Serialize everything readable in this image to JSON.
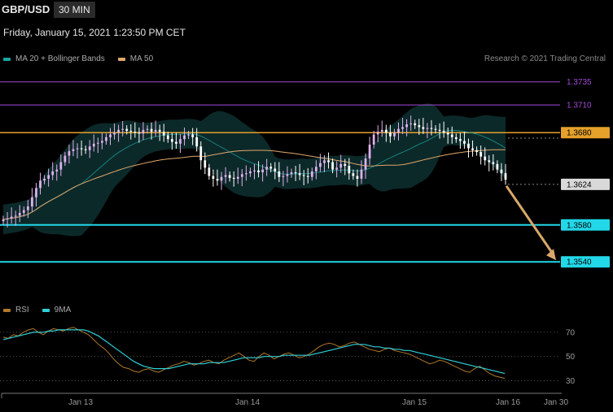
{
  "header": {
    "symbol": "GBP/USD",
    "timeframe": "30 MIN",
    "datetime": "Friday, January 15, 2021 1:23:50 PM CET"
  },
  "legend": {
    "main": [
      {
        "label": "MA 20 + Bollinger Bands",
        "color": "#1aa6a6"
      },
      {
        "label": "MA 50",
        "color": "#e0a86a"
      }
    ],
    "rsi": [
      {
        "label": "RSI",
        "color": "#b07a2a"
      },
      {
        "label": "9MA",
        "color": "#2fd0d8"
      }
    ]
  },
  "credit": "Research © 2021 Trading Central",
  "colors": {
    "background": "#000000",
    "resistance_purple": "#a24bd6",
    "pivot_orange": "#e5a12a",
    "support_cyan": "#22d8e8",
    "last_price_label": "#d9d9d9",
    "arrow": "#d9a86a",
    "candle_up": "#e0b0ee",
    "candle_down": "#ffffff",
    "band_fill": "#0d2e2e"
  },
  "chart_data": [
    {
      "type": "candlestick",
      "title": "GBP/USD 30 MIN",
      "ylim": [
        1.3505,
        1.3755
      ],
      "x_ticks": [
        "Jan 13",
        "Jan 14",
        "Jan 15",
        "Jan 16",
        "Jan 30"
      ],
      "levels": [
        {
          "value": 1.3735,
          "label": "1.3735",
          "kind": "resistance"
        },
        {
          "value": 1.371,
          "label": "1.3710",
          "kind": "resistance"
        },
        {
          "value": 1.368,
          "label": "1.3680",
          "kind": "pivot"
        },
        {
          "value": 1.3624,
          "label": "1.3624",
          "kind": "last_price"
        },
        {
          "value": 1.358,
          "label": "1.3580",
          "kind": "support"
        },
        {
          "value": 1.354,
          "label": "1.3540",
          "kind": "support"
        }
      ],
      "close_series": [
        1.3586,
        1.3587,
        1.3589,
        1.359,
        1.3593,
        1.3596,
        1.36,
        1.361,
        1.362,
        1.3628,
        1.363,
        1.3634,
        1.3638,
        1.364,
        1.3648,
        1.3655,
        1.366,
        1.3662,
        1.3663,
        1.3662,
        1.3661,
        1.3665,
        1.3668,
        1.3669,
        1.3671,
        1.3675,
        1.3678,
        1.368,
        1.3683,
        1.3684,
        1.3682,
        1.3681,
        1.368,
        1.3679,
        1.3683,
        1.3684,
        1.3681,
        1.3683,
        1.3681,
        1.3677,
        1.3673,
        1.367,
        1.3668,
        1.3673,
        1.3677,
        1.3678,
        1.3675,
        1.3665,
        1.365,
        1.3642,
        1.3633,
        1.363,
        1.3628,
        1.3632,
        1.3634,
        1.3631,
        1.363,
        1.3632,
        1.3635,
        1.3636,
        1.3638,
        1.3639,
        1.3637,
        1.364,
        1.3643,
        1.3641,
        1.3638,
        1.3632,
        1.3633,
        1.3635,
        1.3637,
        1.3636,
        1.3634,
        1.3633,
        1.3632,
        1.3638,
        1.3643,
        1.3647,
        1.365,
        1.3648,
        1.364,
        1.3642,
        1.3646,
        1.3644,
        1.3636,
        1.3633,
        1.363,
        1.364,
        1.3652,
        1.3667,
        1.3678,
        1.3681,
        1.3683,
        1.368,
        1.3676,
        1.368,
        1.3684,
        1.3686,
        1.3689,
        1.369,
        1.3688,
        1.3686,
        1.3684,
        1.3685,
        1.3684,
        1.3683,
        1.3682,
        1.368,
        1.3678,
        1.3675,
        1.3673,
        1.3671,
        1.3668,
        1.3663,
        1.3661,
        1.3659,
        1.3654,
        1.365,
        1.3648,
        1.3646,
        1.364,
        1.3636,
        1.3629
      ],
      "projection": {
        "from": 1.3624,
        "to": 1.354
      }
    },
    {
      "type": "line",
      "title": "RSI",
      "ylim": [
        25,
        80
      ],
      "y_ticks": [
        70,
        50,
        30
      ],
      "series": [
        {
          "name": "RSI",
          "values": [
            66,
            65,
            68,
            67,
            70,
            72,
            73,
            70,
            68,
            71,
            73,
            72,
            71,
            73,
            74,
            72,
            70,
            68,
            64,
            60,
            57,
            53,
            48,
            44,
            41,
            40,
            38,
            37,
            39,
            40,
            38,
            37,
            39,
            41,
            43,
            44,
            46,
            45,
            43,
            44,
            46,
            47,
            45,
            44,
            47,
            49,
            51,
            53,
            50,
            47,
            46,
            50,
            53,
            51,
            48,
            50,
            52,
            53,
            51,
            49,
            50,
            52,
            55,
            58,
            60,
            61,
            60,
            58,
            59,
            61,
            62,
            60,
            58,
            56,
            55,
            54,
            56,
            57,
            55,
            54,
            53,
            52,
            50,
            48,
            46,
            44,
            45,
            47,
            46,
            44,
            42,
            40,
            38,
            37,
            40,
            42,
            39,
            36,
            34,
            33,
            32
          ]
        },
        {
          "name": "9MA",
          "values": [
            64,
            65,
            66,
            67,
            68,
            69,
            70,
            70,
            70,
            71,
            71,
            72,
            72,
            72,
            72,
            72,
            72,
            71,
            69,
            67,
            64,
            61,
            58,
            55,
            52,
            49,
            46,
            44,
            42,
            41,
            40,
            40,
            40,
            40,
            41,
            42,
            43,
            44,
            44,
            44,
            44,
            45,
            45,
            45,
            45,
            46,
            47,
            48,
            49,
            49,
            49,
            49,
            50,
            50,
            50,
            50,
            51,
            51,
            51,
            51,
            51,
            51,
            52,
            53,
            54,
            55,
            56,
            57,
            58,
            59,
            60,
            60,
            60,
            59,
            58,
            58,
            57,
            57,
            56,
            56,
            55,
            55,
            54,
            53,
            52,
            51,
            50,
            49,
            48,
            47,
            46,
            45,
            44,
            43,
            42,
            41,
            40,
            39,
            38,
            37,
            36
          ]
        }
      ]
    }
  ]
}
